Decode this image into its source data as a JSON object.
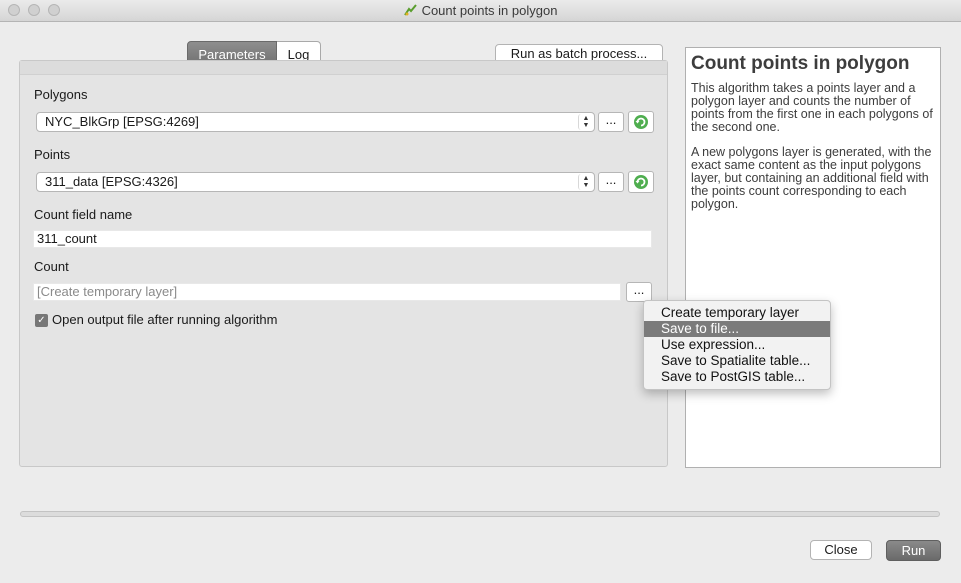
{
  "window": {
    "title": "Count points in polygon"
  },
  "tabs": [
    {
      "label": "Parameters",
      "active": true
    },
    {
      "label": "Log",
      "active": false
    }
  ],
  "batch_button": "Run as batch process...",
  "form": {
    "polygons": {
      "label": "Polygons",
      "value": "NYC_BlkGrp [EPSG:4269]",
      "dots": "..."
    },
    "points": {
      "label": "Points",
      "value": "311_data [EPSG:4326]",
      "dots": "..."
    },
    "count_field": {
      "label": "Count field name",
      "value": "311_count"
    },
    "count": {
      "label": "Count",
      "placeholder": "[Create temporary layer]",
      "dots": "..."
    },
    "open_output": {
      "label": "Open output file after running algorithm",
      "checked": true
    }
  },
  "help": {
    "title": "Count points in polygon",
    "paragraphs": [
      "This algorithm takes a points layer and a polygon layer and counts the number of points from the first one in each polygons of the second one.",
      "A new polygons layer is generated, with the exact same content as the input polygons layer, but containing an additional field with the points count corresponding to each polygon."
    ]
  },
  "output_menu": {
    "items": [
      "Create temporary layer",
      "Save to file...",
      "Use expression...",
      "Save to Spatialite table...",
      "Save to PostGIS table..."
    ],
    "selected_index": 1
  },
  "progress": {
    "value": 0
  },
  "buttons": {
    "close": "Close",
    "run": "Run"
  },
  "colors": {
    "accent": "#7b7b7b",
    "iterate_icon": "#3a9b3a"
  }
}
